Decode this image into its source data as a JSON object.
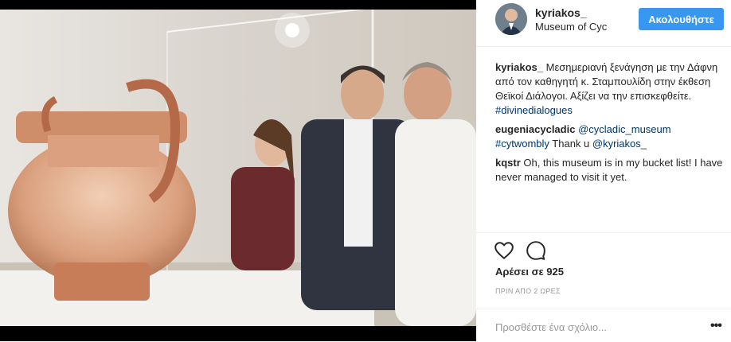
{
  "post": {
    "username": "kyriakos_",
    "location": "Museum of Cyc...",
    "follow_label": "Ακολουθήστε",
    "likes": "Αρέσει σε 925",
    "time_ago": "ΠΡΙΝ ΑΠΟ 2 ΩΡΕΣ",
    "comment_placeholder": "Προσθέστε ένα σχόλιο...",
    "more_label": "•••"
  },
  "comments": [
    {
      "user": "kyriakos_",
      "text": "Μεσημεριανή ξενάγηση με την Δάφνη από τον καθηγητή κ. Σταμπουλίδη στην έκθεση Θεϊκοί Διάλογοι. Αξίζει να την επισκεφθείτε. ",
      "link": "#divinedialogues"
    },
    {
      "user": "eugeniacycladic",
      "link1": "@cycladic_museum",
      "link2": "#cytwombly",
      "text": " Thank u ",
      "link3": "@kyriakos_"
    },
    {
      "user": "kqstr",
      "text": "Oh, this museum is in my bucket list! I have never managed to visit it yet."
    }
  ],
  "icons": {
    "like": "heart-icon",
    "comment": "speech-bubble-icon"
  },
  "colors": {
    "follow_button": "#3897f0",
    "link": "#003569",
    "muted": "#999999"
  }
}
